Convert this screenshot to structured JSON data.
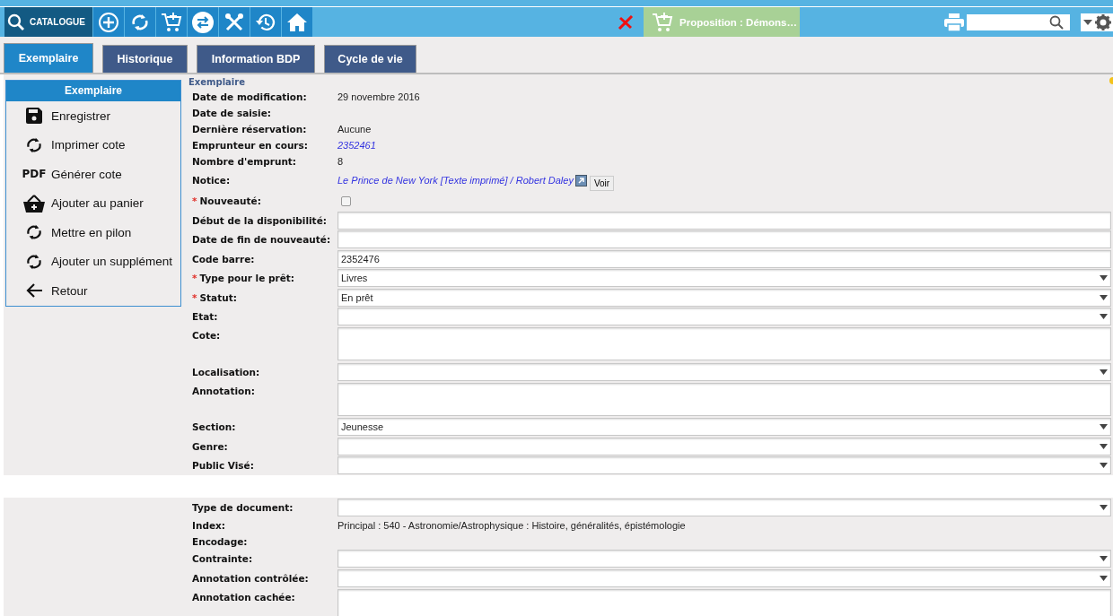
{
  "toolbar": {
    "catalogue_label": "CATALOGUE",
    "proposition": {
      "label": "Proposition : Démons…"
    }
  },
  "tabs": [
    {
      "label": "Exemplaire",
      "selected": true
    },
    {
      "label": "Historique",
      "selected": false
    },
    {
      "label": "Information BDP",
      "selected": false
    },
    {
      "label": "Cycle de vie",
      "selected": false
    }
  ],
  "side_menu": {
    "title": "Exemplaire",
    "items": [
      {
        "label": "Enregistrer",
        "kind": "save"
      },
      {
        "label": "Imprimer cote",
        "kind": "refresh"
      },
      {
        "label": "Générer cote",
        "kind": "pdf",
        "icon_text": "PDF"
      },
      {
        "label": "Ajouter au panier",
        "kind": "basket"
      },
      {
        "label": "Mettre en pilon",
        "kind": "refresh"
      },
      {
        "label": "Ajouter un supplément",
        "kind": "refresh"
      },
      {
        "label": "Retour",
        "kind": "back"
      }
    ]
  },
  "form": {
    "title": "Exemplaire",
    "required_mark": "*",
    "sections": [
      {
        "fields": [
          {
            "label": "Date de modification:",
            "required": false,
            "kind": "text",
            "value": "29 novembre 2016"
          },
          {
            "label": "Date de saisie:",
            "required": false,
            "kind": "text"
          },
          {
            "label": "Dernière réservation:",
            "required": false,
            "kind": "text",
            "value": "Aucune"
          },
          {
            "label": "Emprunteur en cours:",
            "required": false,
            "kind": "link",
            "value": "2352461"
          },
          {
            "label": "Nombre d'emprunt:",
            "required": false,
            "kind": "text",
            "value": "8"
          },
          {
            "label": "Notice:",
            "required": false,
            "kind": "link",
            "value": "Le Prince de New York [Texte imprimé] / Robert Daley",
            "button": "Voir"
          },
          {
            "label": "Nouveauté:",
            "required": true,
            "kind": "checkbox",
            "checked": false
          },
          {
            "label": "Début de la disponibilité:",
            "required": false,
            "kind": "input"
          },
          {
            "label": "Date de fin de nouveauté:",
            "required": false,
            "kind": "input"
          },
          {
            "label": "Code barre:",
            "required": false,
            "kind": "input",
            "value": "2352476"
          },
          {
            "label": "Type pour le prêt:",
            "required": true,
            "kind": "select",
            "value": "Livres"
          },
          {
            "label": "Statut:",
            "required": true,
            "kind": "select",
            "value": "En prêt"
          },
          {
            "label": "Etat:",
            "required": false,
            "kind": "select"
          },
          {
            "label": "Cote:",
            "required": false,
            "kind": "textarea"
          },
          {
            "label": "Localisation:",
            "required": false,
            "kind": "select"
          },
          {
            "label": "Annotation:",
            "required": false,
            "kind": "textarea"
          },
          {
            "label": "Section:",
            "required": false,
            "kind": "select",
            "value": "Jeunesse"
          },
          {
            "label": "Genre:",
            "required": false,
            "kind": "select"
          },
          {
            "label": "Public Visé:",
            "required": false,
            "kind": "select"
          }
        ]
      },
      {
        "fields": [
          {
            "label": "Type de document:",
            "required": false,
            "kind": "select"
          },
          {
            "label": "Index:",
            "required": false,
            "kind": "text",
            "value": "Principal : 540 - Astronomie/Astrophysique : Histoire, généralités, épistémologie"
          },
          {
            "label": "Encodage:",
            "required": false,
            "kind": "text"
          },
          {
            "label": "Contrainte:",
            "required": false,
            "kind": "select"
          },
          {
            "label": "Annotation contrôlée:",
            "required": false,
            "kind": "select"
          },
          {
            "label": "Annotation cachée:",
            "required": false,
            "kind": "textarea"
          }
        ]
      }
    ]
  }
}
